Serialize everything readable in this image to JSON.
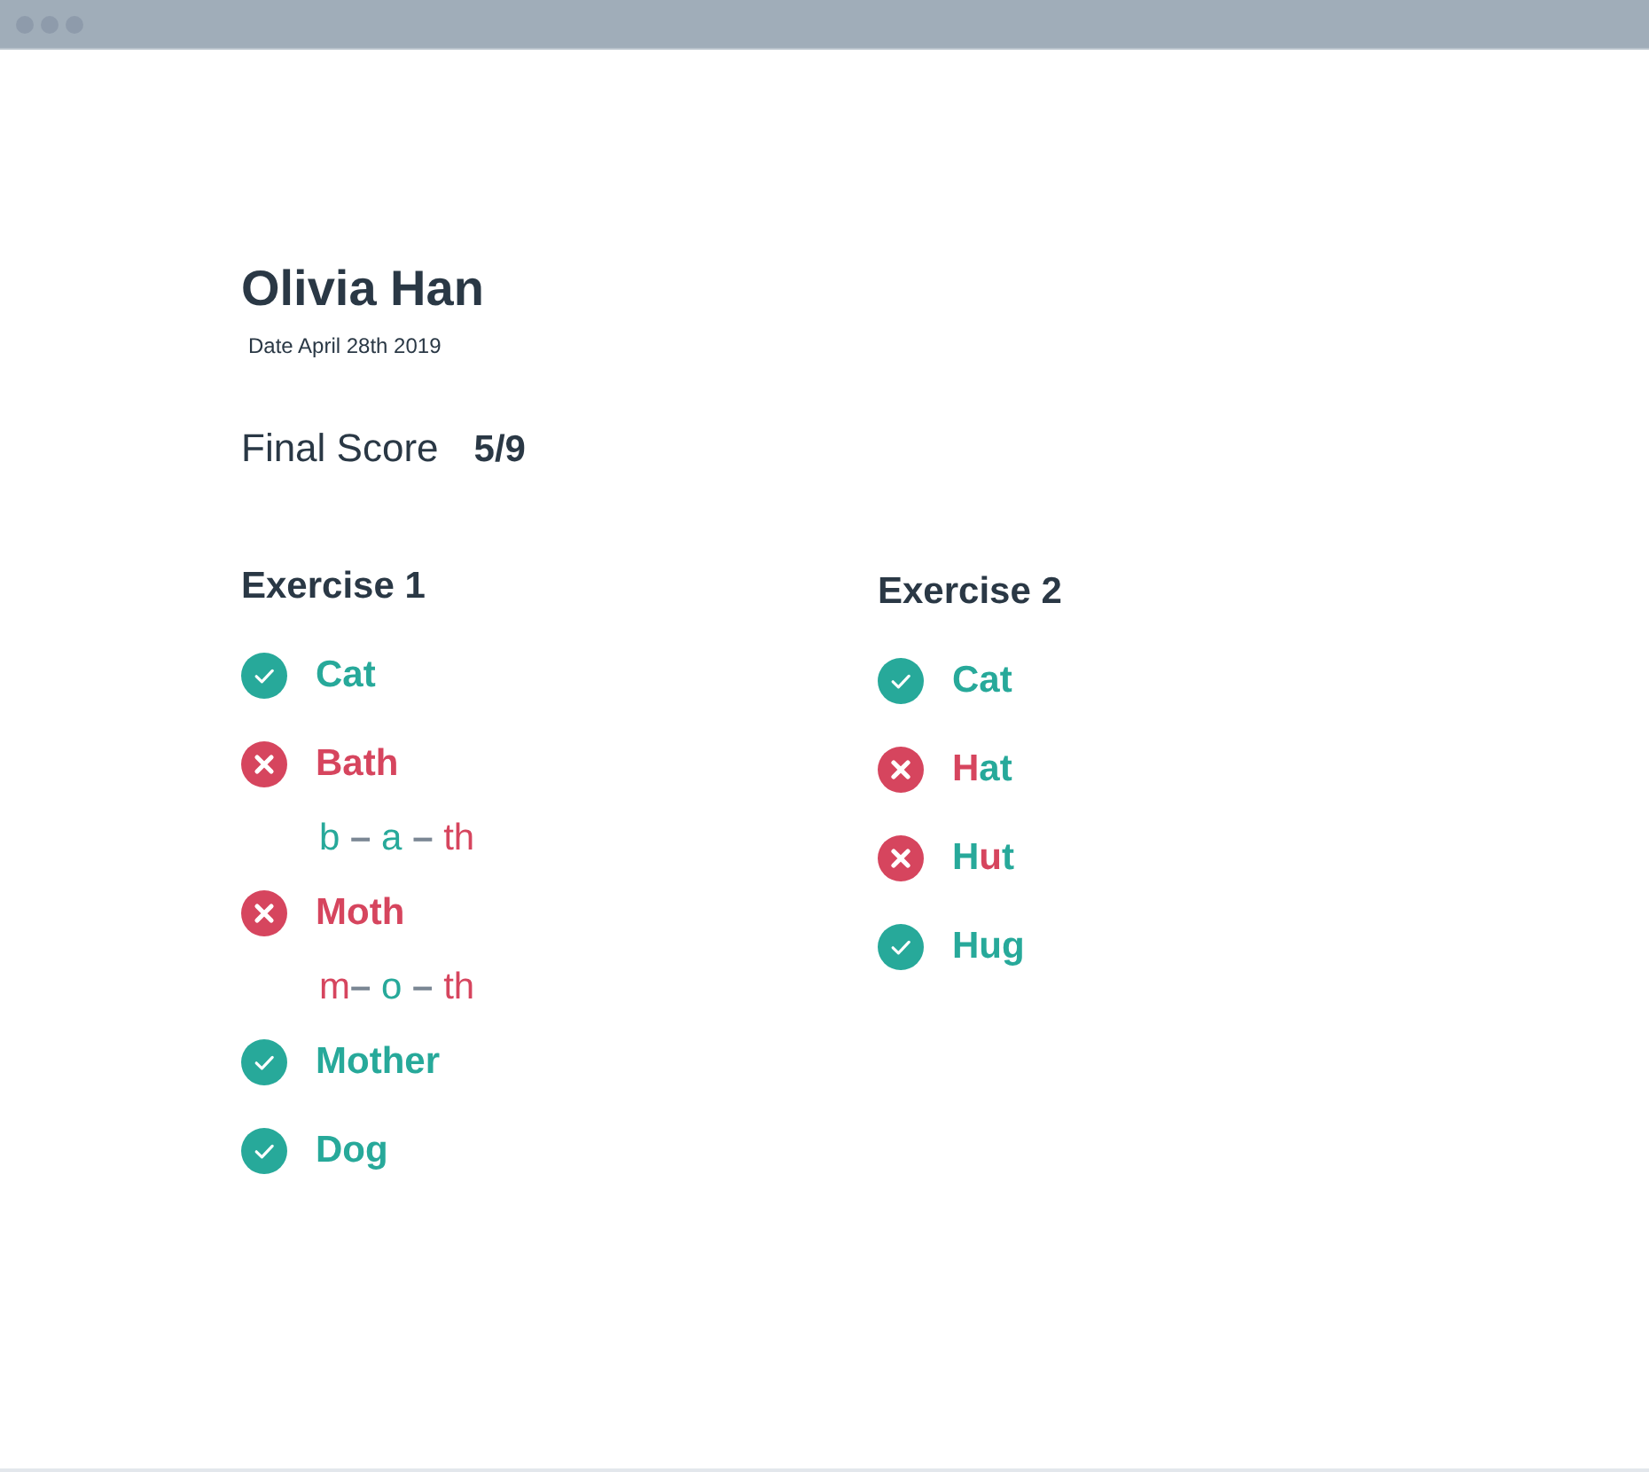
{
  "student": {
    "name": "Olivia Han",
    "date": "Date April 28th 2019"
  },
  "score": {
    "label": "Final Score",
    "value": "5/9"
  },
  "exercises": [
    {
      "title": "Exercise 1",
      "items": [
        {
          "correct": true,
          "word": [
            {
              "text": "Cat",
              "correct": true
            }
          ]
        },
        {
          "correct": false,
          "word": [
            {
              "text": "Bath",
              "correct": false
            }
          ],
          "breakdown": [
            {
              "kind": "sound",
              "text": "b",
              "correct": true
            },
            {
              "kind": "separator",
              "text": " – "
            },
            {
              "kind": "sound",
              "text": "a",
              "correct": true
            },
            {
              "kind": "separator",
              "text": " – "
            },
            {
              "kind": "sound",
              "text": "th",
              "correct": false
            }
          ]
        },
        {
          "correct": false,
          "word": [
            {
              "text": "Moth",
              "correct": false
            }
          ],
          "breakdown": [
            {
              "kind": "sound",
              "text": "m",
              "correct": false
            },
            {
              "kind": "separator",
              "text": "– "
            },
            {
              "kind": "sound",
              "text": "o",
              "correct": true
            },
            {
              "kind": "separator",
              "text": " – "
            },
            {
              "kind": "sound",
              "text": "th",
              "correct": false
            }
          ]
        },
        {
          "correct": true,
          "word": [
            {
              "text": "Mother",
              "correct": true
            }
          ]
        },
        {
          "correct": true,
          "word": [
            {
              "text": "Dog",
              "correct": true
            }
          ]
        }
      ]
    },
    {
      "title": "Exercise 2",
      "items": [
        {
          "correct": true,
          "word": [
            {
              "text": "Cat",
              "correct": true
            }
          ]
        },
        {
          "correct": false,
          "word": [
            {
              "text": "H",
              "correct": false
            },
            {
              "text": "at",
              "correct": true
            }
          ]
        },
        {
          "correct": false,
          "word": [
            {
              "text": "H",
              "correct": true
            },
            {
              "text": "u",
              "correct": false
            },
            {
              "text": "t",
              "correct": true
            }
          ]
        },
        {
          "correct": true,
          "word": [
            {
              "text": "Hug",
              "correct": true
            }
          ]
        }
      ]
    }
  ]
}
